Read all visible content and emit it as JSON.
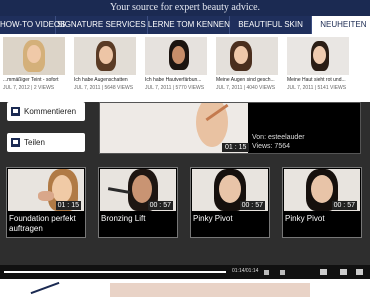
{
  "header": {
    "tagline": "Your source for expert beauty advice."
  },
  "tabs": [
    {
      "label": "HOW-TO VIDEOS",
      "active": false
    },
    {
      "label": "SIGNATURE SERVICES",
      "active": false
    },
    {
      "label": "LERNE TOM KENNEN",
      "active": false
    },
    {
      "label": "BEAUTIFUL SKIN",
      "active": false
    },
    {
      "label": "NEUHEITEN",
      "active": true
    }
  ],
  "dropdown_videos": [
    {
      "title": "...mmäßiger Teint - sofort",
      "meta": "JUL 7, 2012 | 2 VIEWS"
    },
    {
      "title": "Ich habe Augenschatten",
      "meta": "JUL 7, 2011 | 5648 VIEWS"
    },
    {
      "title": "Ich habe Hautverfärbun...",
      "meta": "JUL 7, 2011 | 5770 VIEWS"
    },
    {
      "title": "Meine Augen sind gesch...",
      "meta": "JUL 7, 2011 | 4040 VIEWS"
    },
    {
      "title": "Meine Haut sieht rot und...",
      "meta": "JUL 7, 2011 | 5141 VIEWS"
    }
  ],
  "sidebar": {
    "comment_label": "Kommentieren",
    "share_label": "Teilen"
  },
  "main_video": {
    "duration": "01 : 15",
    "by": "Von: esteelauder",
    "views": "Views: 7564"
  },
  "related": [
    {
      "title": "Foundation perfekt auftragen",
      "duration": "01 : 15"
    },
    {
      "title": "Bronzing Lift",
      "duration": "00 : 57"
    },
    {
      "title": "Pinky Pivot",
      "duration": "00 : 57"
    },
    {
      "title": "Pinky Pivot",
      "duration": "00 : 57"
    }
  ],
  "player": {
    "time": "01:14/01:14",
    "progress": 1.0
  },
  "colors": {
    "navy": "#1b2a52",
    "dark_bg": "#2e2e2e"
  }
}
